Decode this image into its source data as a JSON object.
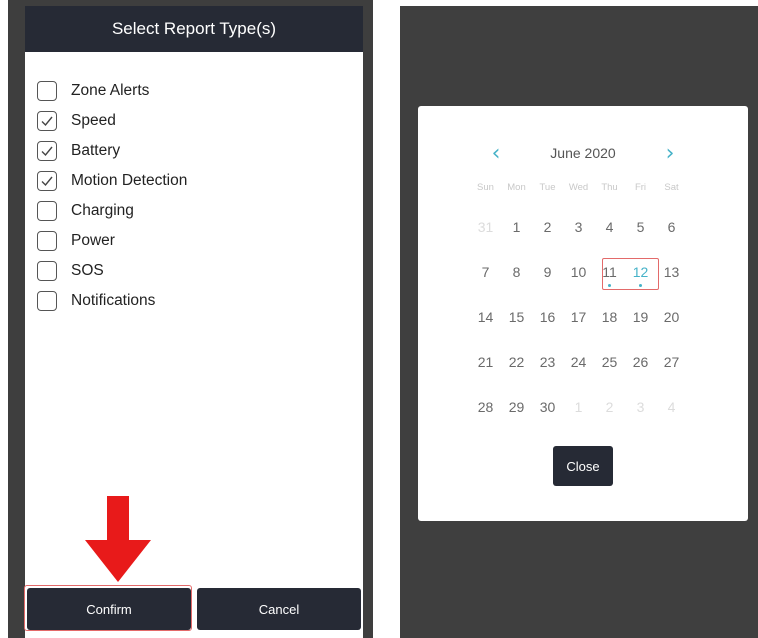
{
  "report_dialog": {
    "title": "Select Report Type(s)",
    "items": [
      {
        "label": "Zone Alerts",
        "checked": false
      },
      {
        "label": "Speed",
        "checked": true
      },
      {
        "label": "Battery",
        "checked": true
      },
      {
        "label": "Motion Detection",
        "checked": true
      },
      {
        "label": "Charging",
        "checked": false
      },
      {
        "label": "Power",
        "checked": false
      },
      {
        "label": "SOS",
        "checked": false
      },
      {
        "label": "Notifications",
        "checked": false
      }
    ],
    "confirm_label": "Confirm",
    "cancel_label": "Cancel"
  },
  "calendar": {
    "title": "June 2020",
    "prev_icon": "‹",
    "next_icon": "›",
    "weekdays": [
      "Sun",
      "Mon",
      "Tue",
      "Wed",
      "Thu",
      "Fri",
      "Sat"
    ],
    "weeks": [
      [
        "31",
        "1",
        "2",
        "3",
        "4",
        "5",
        "6"
      ],
      [
        "7",
        "8",
        "9",
        "10",
        "11",
        "12",
        "13"
      ],
      [
        "14",
        "15",
        "16",
        "17",
        "18",
        "19",
        "20"
      ],
      [
        "21",
        "22",
        "23",
        "24",
        "25",
        "26",
        "27"
      ],
      [
        "28",
        "29",
        "30",
        "1",
        "2",
        "3",
        "4"
      ]
    ],
    "close_label": "Close"
  },
  "colors": {
    "header_bg": "#262a35",
    "accent": "#46b2c8",
    "highlight": "#e36a6a",
    "arrow": "#e81a1a"
  }
}
